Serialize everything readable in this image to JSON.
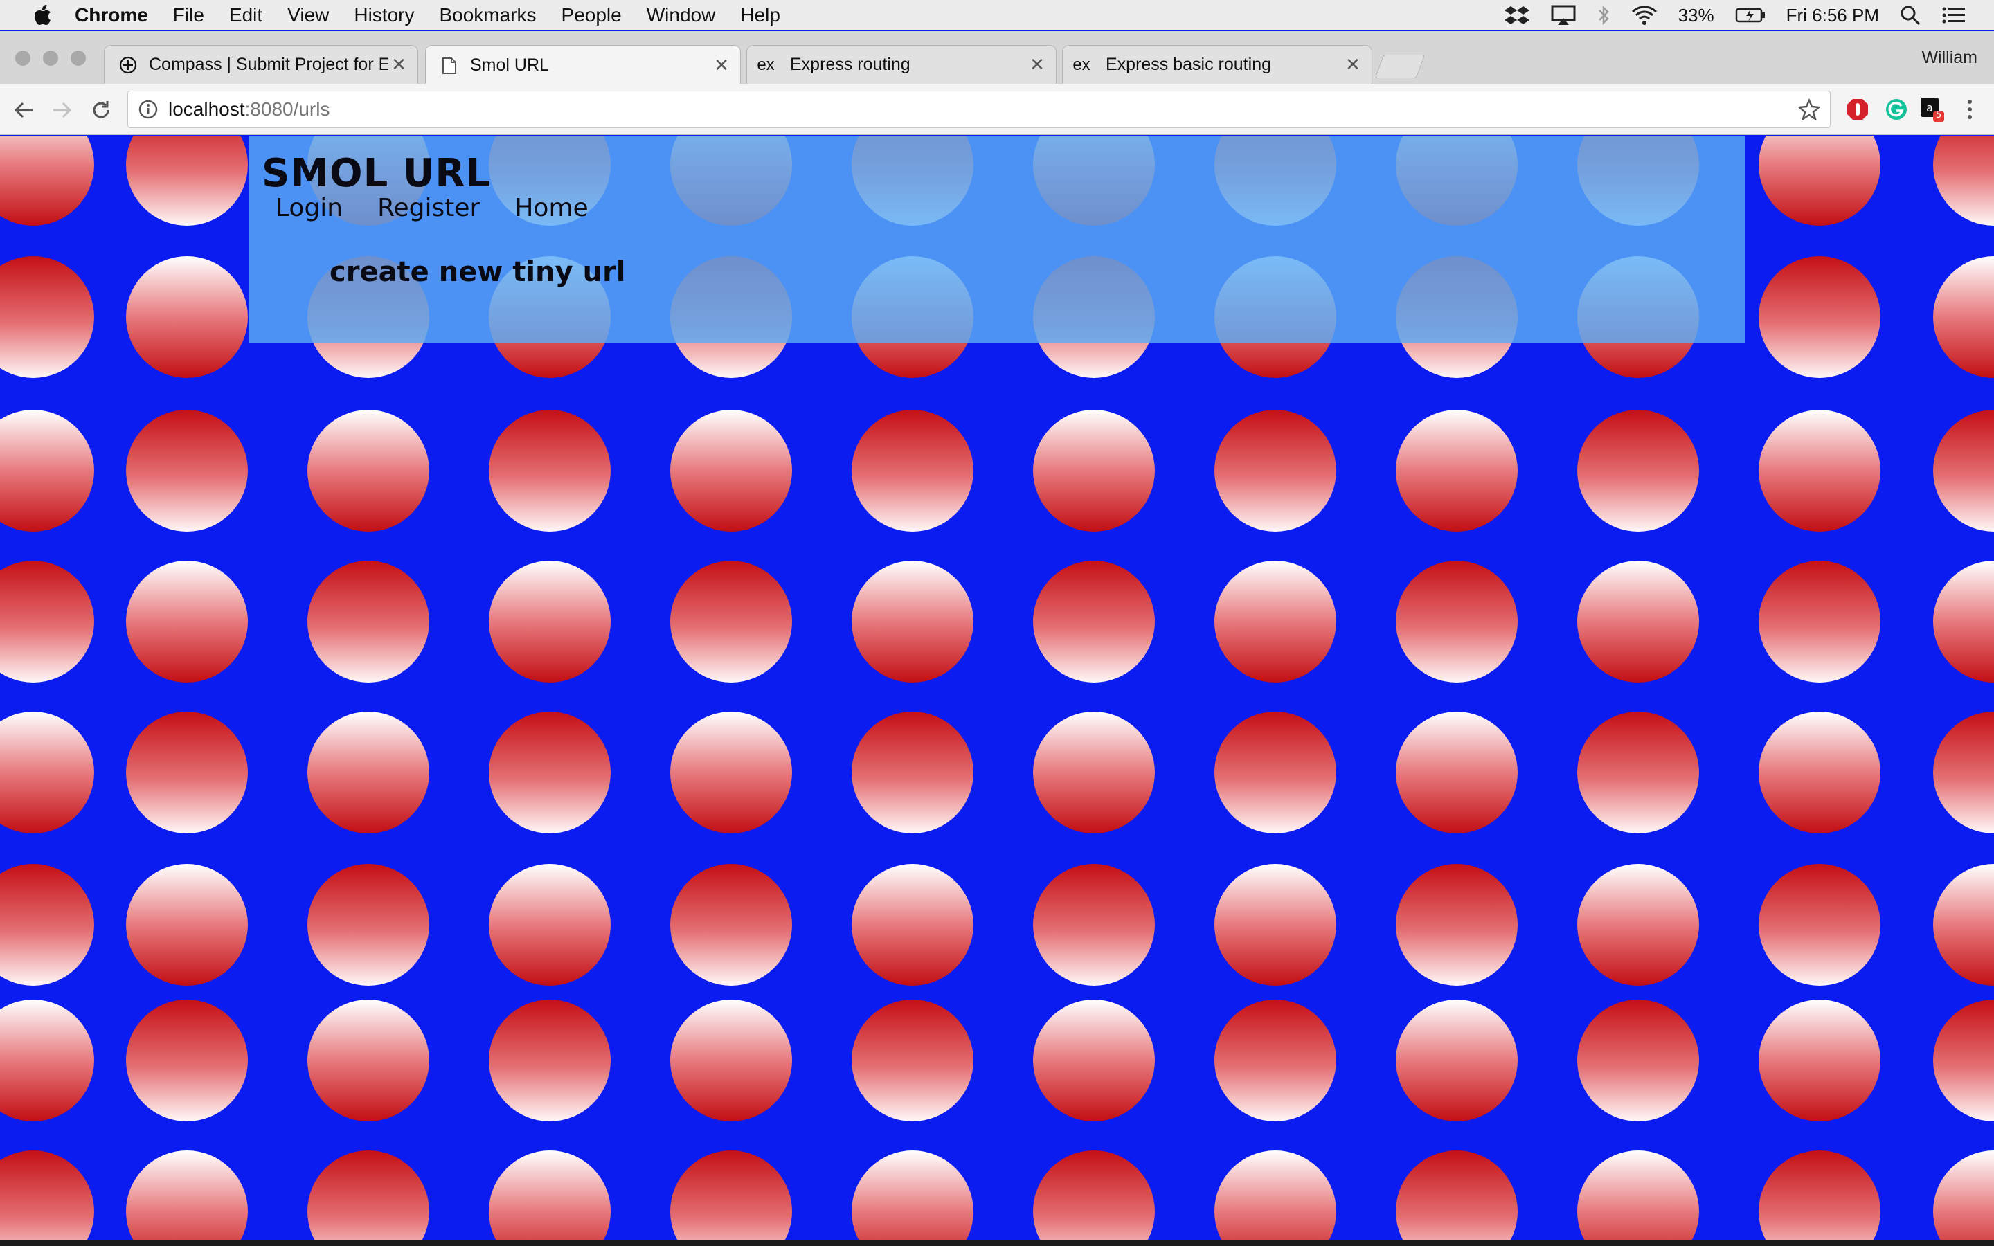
{
  "menubar": {
    "app_name": "Chrome",
    "items": [
      "File",
      "Edit",
      "View",
      "History",
      "Bookmarks",
      "People",
      "Window",
      "Help"
    ],
    "battery": "33%",
    "clock": "Fri 6:56 PM"
  },
  "browser": {
    "tabs": [
      {
        "title": "Compass | Submit Project for E",
        "favicon": "compass-icon"
      },
      {
        "title": "Smol URL",
        "favicon": "page-icon"
      },
      {
        "title": "Express routing",
        "favicon": "ex"
      },
      {
        "title": "Express basic routing",
        "favicon": "ex"
      }
    ],
    "profile_name": "William",
    "url_host": "localhost",
    "url_path": ":8080/urls",
    "extension_badge": "5"
  },
  "page": {
    "brand": "SMOL URL",
    "nav": {
      "login": "Login",
      "register": "Register",
      "home": "Home"
    },
    "create_link": "create new tiny url",
    "colors": {
      "background": "#0a1cf0",
      "panel": "#5cacf5",
      "dot_red": "#c51016"
    }
  }
}
